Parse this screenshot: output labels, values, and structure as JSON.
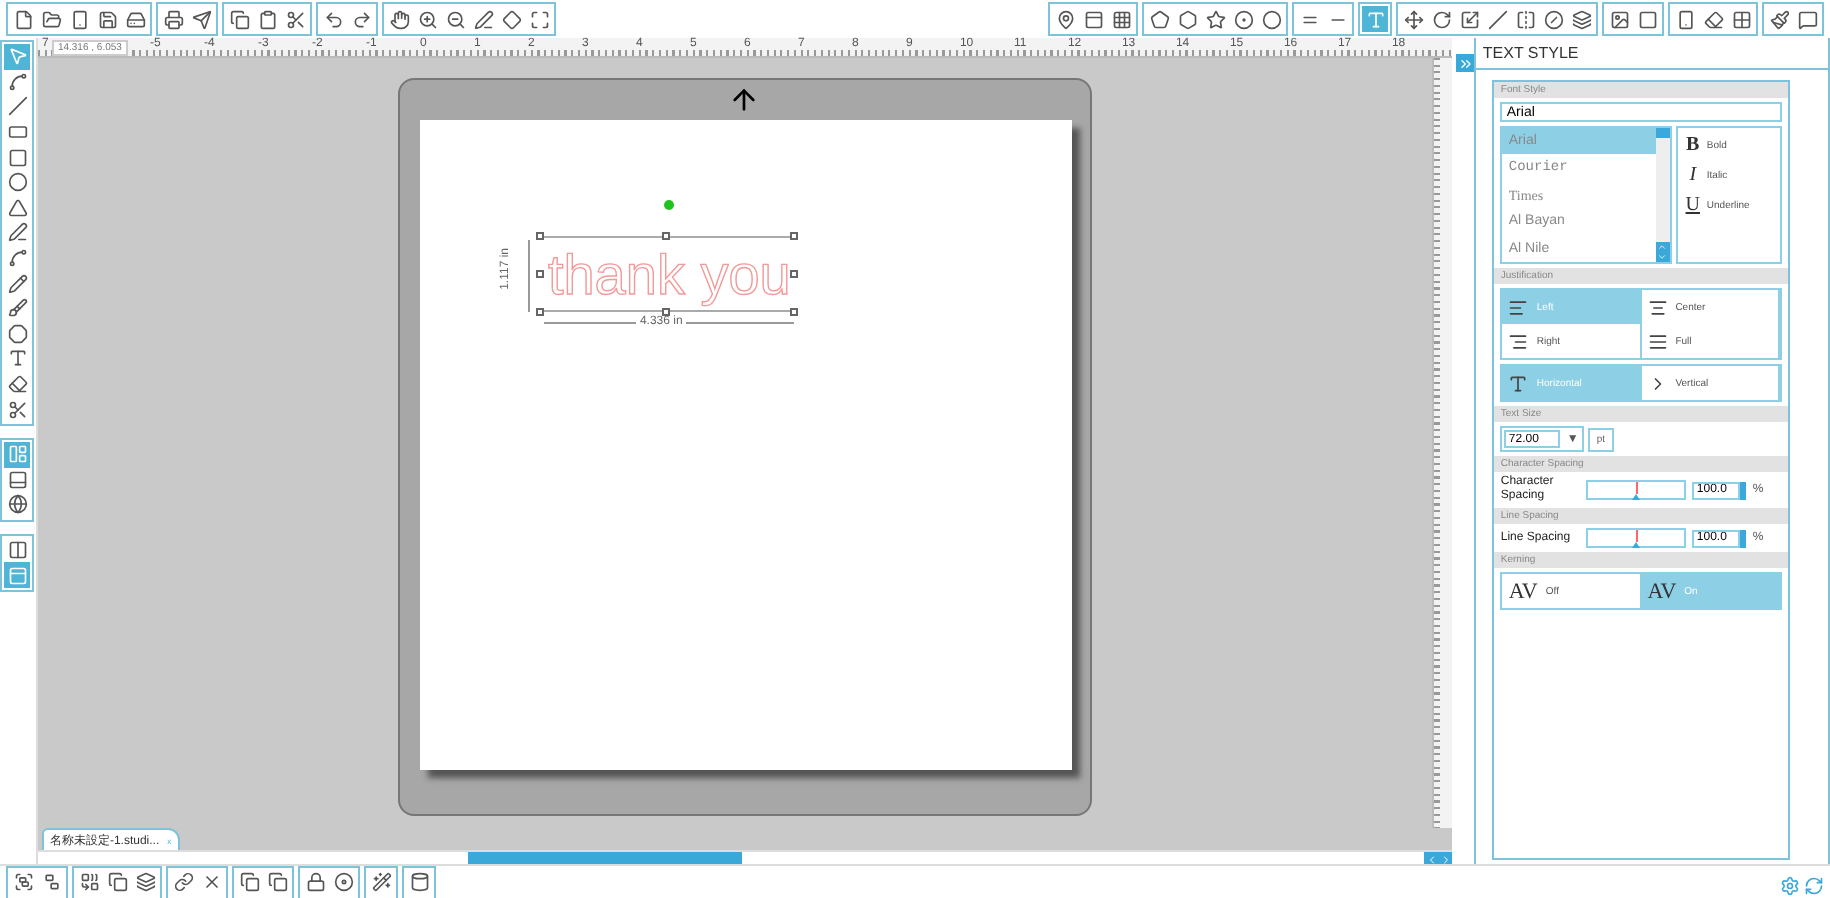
{
  "top_toolbar_right": [
    {
      "selected": false
    },
    {
      "selected": false
    },
    {
      "selected": false
    },
    {
      "selected": false
    },
    {
      "selected": false
    },
    {
      "selected": false
    },
    {
      "selected": false
    },
    {
      "selected": false
    },
    {
      "selected": false
    },
    {
      "selected": false
    },
    {
      "selected": true
    },
    {
      "selected": false
    },
    {
      "selected": false
    },
    {
      "selected": false
    },
    {
      "selected": false
    },
    {
      "selected": false
    },
    {
      "selected": false
    },
    {
      "selected": false
    },
    {
      "selected": false
    },
    {
      "selected": false
    },
    {
      "selected": false
    },
    {
      "selected": false
    },
    {
      "selected": false
    },
    {
      "selected": false
    },
    {
      "selected": false
    }
  ],
  "left_toolbar": [
    {
      "selected": true
    },
    {
      "selected": false
    },
    {
      "selected": false
    },
    {
      "selected": false
    },
    {
      "selected": false
    },
    {
      "selected": false
    },
    {
      "selected": false
    },
    {
      "selected": false
    },
    {
      "selected": false
    },
    {
      "selected": false
    },
    {
      "selected": false
    },
    {
      "selected": false
    },
    {
      "selected": false
    },
    {
      "selected": false
    },
    {
      "selected": false
    },
    {
      "selected": true
    },
    {
      "selected": false
    },
    {
      "selected": false
    },
    {
      "selected": false
    },
    {
      "selected": true
    }
  ],
  "ruler": {
    "coordinates": "14.316 , 6.053",
    "edge_label": "7",
    "labels": [
      "-5",
      "-4",
      "-3",
      "-2",
      "-1",
      "0",
      "1",
      "2",
      "3",
      "4",
      "5",
      "6",
      "7",
      "8",
      "9",
      "10",
      "11",
      "12",
      "13",
      "14",
      "15",
      "16",
      "17",
      "18"
    ]
  },
  "canvas": {
    "text": "thank you",
    "height_label": "1.117 in",
    "width_label": "4.336 in"
  },
  "document_tab": {
    "label": "名称未設定-1.studi...",
    "badge": "x"
  },
  "panel": {
    "title": "TEXT STYLE",
    "font_style": {
      "header": "Font Style",
      "value": "Arial",
      "fonts": [
        {
          "name": "Arial",
          "selected": true
        },
        {
          "name": "Courier",
          "selected": false
        },
        {
          "name": "Times",
          "selected": false
        },
        {
          "name": "Al Bayan",
          "selected": false
        },
        {
          "name": "Al Nile",
          "selected": false
        }
      ],
      "styles": [
        {
          "label": "Bold",
          "glyph": "B",
          "kind": "bold"
        },
        {
          "label": "Italic",
          "glyph": "I",
          "kind": "italic"
        },
        {
          "label": "Underline",
          "glyph": "U",
          "kind": "underline"
        }
      ]
    },
    "justification": {
      "header": "Justification",
      "options": [
        {
          "label": "Left",
          "selected": true
        },
        {
          "label": "Center",
          "selected": false
        },
        {
          "label": "Right",
          "selected": false
        },
        {
          "label": "Full",
          "selected": false
        }
      ],
      "orientations": [
        {
          "label": "Horizontal",
          "selected": true
        },
        {
          "label": "Vertical",
          "selected": false
        }
      ]
    },
    "text_size": {
      "header": "Text Size",
      "value": "72.00",
      "dropdown": "▼",
      "unit": "pt"
    },
    "character_spacing": {
      "header": "Character Spacing",
      "label": "Character Spacing",
      "value": "100.0",
      "unit": "%",
      "level": 0.5
    },
    "line_spacing": {
      "header": "Line Spacing",
      "label": "Line Spacing",
      "value": "100.0",
      "unit": "%",
      "level": 0.5
    },
    "kerning": {
      "header": "Kerning",
      "options": [
        {
          "glyph": "AV",
          "label": "Off",
          "selected": false
        },
        {
          "glyph": "AV",
          "label": "On",
          "selected": true
        }
      ]
    }
  }
}
